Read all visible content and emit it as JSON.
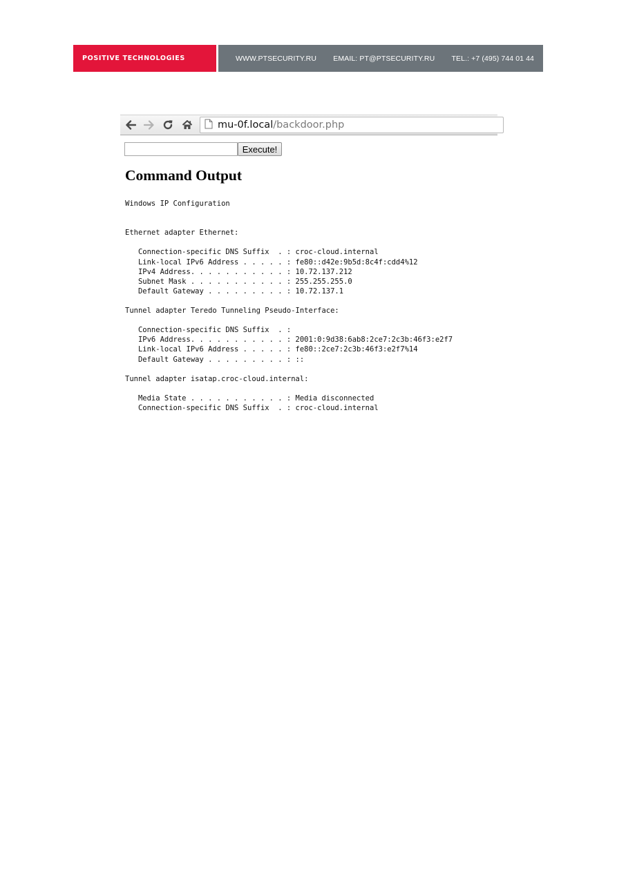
{
  "banner": {
    "brand": "POSITIVE TECHNOLOGIES",
    "website": "WWW.PTSECURITY.RU",
    "email": "EMAIL: PT@PTSECURITY.RU",
    "phone": "TEL.: +7 (495) 744 01 44",
    "brand_color": "#e3153a",
    "bar_color": "#6c747a"
  },
  "browser": {
    "url_host": "mu-0f.local",
    "url_path": "/backdoor.php",
    "icons": [
      "back-icon",
      "forward-icon",
      "reload-icon",
      "home-icon",
      "page-icon"
    ]
  },
  "form": {
    "command_value": "",
    "execute_label": "Execute!"
  },
  "output": {
    "heading": "Command Output",
    "lines": [
      "Windows IP Configuration",
      "",
      "",
      "Ethernet adapter Ethernet:",
      "",
      "   Connection-specific DNS Suffix  . : croc-cloud.internal",
      "   Link-local IPv6 Address . . . . . : fe80::d42e:9b5d:8c4f:cdd4%12",
      "   IPv4 Address. . . . . . . . . . . : 10.72.137.212",
      "   Subnet Mask . . . . . . . . . . . : 255.255.255.0",
      "   Default Gateway . . . . . . . . . : 10.72.137.1",
      "",
      "Tunnel adapter Teredo Tunneling Pseudo-Interface:",
      "",
      "   Connection-specific DNS Suffix  . :",
      "   IPv6 Address. . . . . . . . . . . : 2001:0:9d38:6ab8:2ce7:2c3b:46f3:e2f7",
      "   Link-local IPv6 Address . . . . . : fe80::2ce7:2c3b:46f3:e2f7%14",
      "   Default Gateway . . . . . . . . . : ::",
      "",
      "Tunnel adapter isatap.croc-cloud.internal:",
      "",
      "   Media State . . . . . . . . . . . : Media disconnected",
      "   Connection-specific DNS Suffix  . : croc-cloud.internal"
    ]
  }
}
